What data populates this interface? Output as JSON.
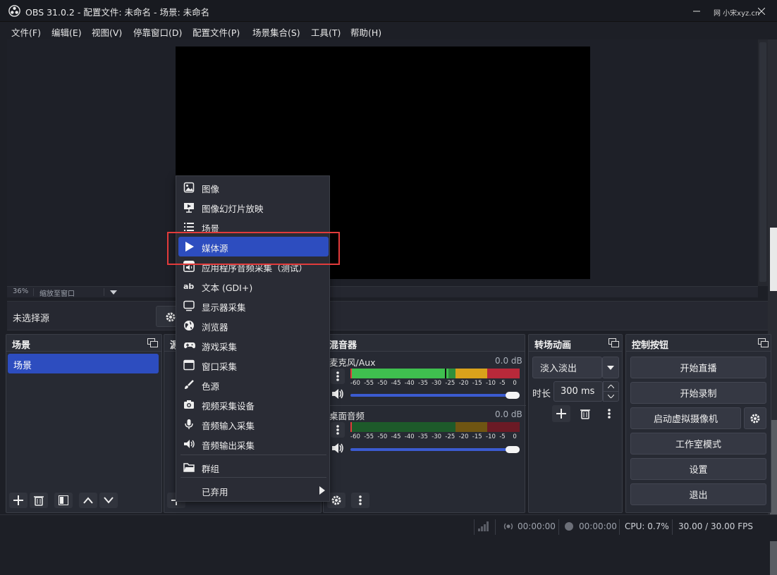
{
  "window": {
    "title": "OBS 31.0.2 - 配置文件: 未命名 - 场景: 未命名",
    "watermark": "网 小宋xyz.cn"
  },
  "menubar": [
    "文件(F)",
    "编辑(E)",
    "视图(V)",
    "停靠窗口(D)",
    "配置文件(P)",
    "场景集合(S)",
    "工具(T)",
    "帮助(H)"
  ],
  "preview": {
    "zoom": "36%",
    "zoom_mode": "缩放至窗口"
  },
  "source_bar": {
    "no_source": "未选择源"
  },
  "docks": {
    "scenes": {
      "title": "场景",
      "items": [
        "场景"
      ]
    },
    "sources": {
      "title": "源"
    },
    "mixer": {
      "title": "混音器",
      "channels": [
        {
          "name": "麦克风/Aux",
          "db": "0.0 dB",
          "level": 0.58
        },
        {
          "name": "桌面音频",
          "db": "0.0 dB",
          "level": 0.0
        }
      ],
      "ticks": [
        "-60",
        "-55",
        "-50",
        "-45",
        "-40",
        "-35",
        "-30",
        "-25",
        "-20",
        "-15",
        "-10",
        "-5",
        "0"
      ]
    },
    "transitions": {
      "title": "转场动画",
      "selected": "淡入淡出",
      "duration_label": "时长",
      "duration_value": "300 ms"
    },
    "controls": {
      "title": "控制按钮",
      "buttons": [
        "开始直播",
        "开始录制",
        "启动虚拟摄像机",
        "工作室模式",
        "设置",
        "退出"
      ]
    }
  },
  "context_menu": {
    "items": [
      {
        "label": "图像",
        "icon": "image-icon"
      },
      {
        "label": "图像幻灯片放映",
        "icon": "slideshow-icon"
      },
      {
        "label": "场景",
        "icon": "list-icon"
      },
      {
        "label": "媒体源",
        "icon": "play-icon",
        "highlighted": true
      },
      {
        "label": "应用程序音频采集（测试）",
        "icon": "app-audio-icon"
      },
      {
        "label": "文本 (GDI+)",
        "icon": "text-icon"
      },
      {
        "label": "显示器采集",
        "icon": "monitor-icon"
      },
      {
        "label": "浏览器",
        "icon": "globe-icon"
      },
      {
        "label": "游戏采集",
        "icon": "gamepad-icon"
      },
      {
        "label": "窗口采集",
        "icon": "window-icon"
      },
      {
        "label": "色源",
        "icon": "brush-icon"
      },
      {
        "label": "视频采集设备",
        "icon": "camera-icon"
      },
      {
        "label": "音频输入采集",
        "icon": "microphone-icon"
      },
      {
        "label": "音频输出采集",
        "icon": "speaker-icon"
      },
      {
        "label": "群组",
        "icon": "folder-icon"
      },
      {
        "label": "已弃用",
        "icon": "submenu-arrow-icon"
      }
    ]
  },
  "statusbar": {
    "stream_time": "00:00:00",
    "record_time": "00:00:00",
    "cpu": "CPU: 0.7%",
    "fps": "30.00 / 30.00 FPS"
  },
  "colors": {
    "accent": "#2d4dbf",
    "annotation": "#e23b3b",
    "meter_green": "#3fbf4f",
    "meter_yellow": "#d9a21b",
    "meter_red": "#b8293a"
  }
}
